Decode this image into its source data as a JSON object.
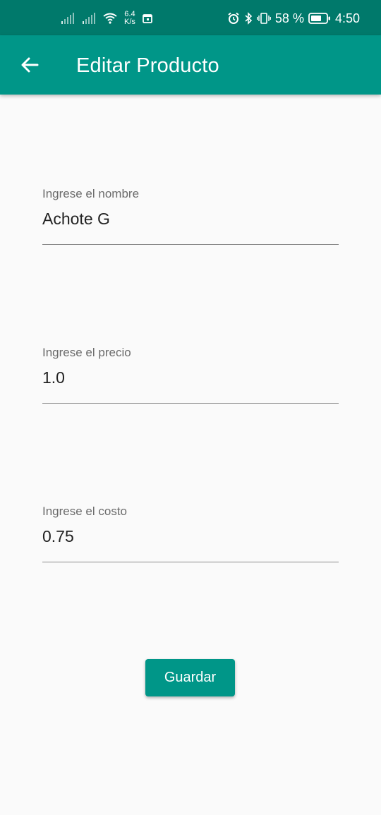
{
  "status_bar": {
    "net_speed_value": "6.4",
    "net_speed_unit": "K/s",
    "battery": "58 %",
    "time": "4:50"
  },
  "app_bar": {
    "title": "Editar Producto",
    "back_icon": "arrow-back-icon"
  },
  "form": {
    "fields": [
      {
        "label": "Ingrese el nombre",
        "value": "Achote G"
      },
      {
        "label": "Ingrese el precio",
        "value": "1.0"
      },
      {
        "label": "Ingrese el costo",
        "value": "0.75"
      }
    ],
    "save_label": "Guardar"
  },
  "colors": {
    "status_bar": "#00796b",
    "primary": "#009688",
    "background": "#fafafa"
  }
}
